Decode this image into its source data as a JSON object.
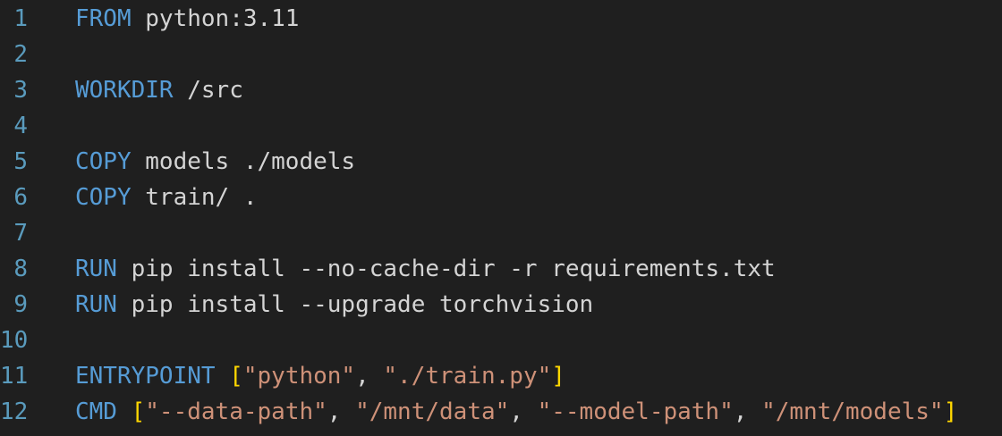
{
  "editor": {
    "language": "Dockerfile",
    "colors": {
      "background": "#1f1f1f",
      "line_number": "#5a9bbd",
      "keyword": "#569cd6",
      "text": "#d4d4d4",
      "bracket": "#ffd700",
      "string": "#ce9178"
    },
    "lines": [
      {
        "number": "1",
        "tokens": [
          {
            "t": "FROM",
            "c": "kw"
          },
          {
            "t": " python:3.11",
            "c": "pl"
          }
        ]
      },
      {
        "number": "2",
        "tokens": []
      },
      {
        "number": "3",
        "tokens": [
          {
            "t": "WORKDIR",
            "c": "kw"
          },
          {
            "t": " /src",
            "c": "pl"
          }
        ]
      },
      {
        "number": "4",
        "tokens": []
      },
      {
        "number": "5",
        "tokens": [
          {
            "t": "COPY",
            "c": "kw"
          },
          {
            "t": " models ./models",
            "c": "pl"
          }
        ]
      },
      {
        "number": "6",
        "tokens": [
          {
            "t": "COPY",
            "c": "kw"
          },
          {
            "t": " train/ .",
            "c": "pl"
          }
        ]
      },
      {
        "number": "7",
        "tokens": []
      },
      {
        "number": "8",
        "tokens": [
          {
            "t": "RUN",
            "c": "kw"
          },
          {
            "t": " pip install --no-cache-dir -r requirements.txt",
            "c": "pl"
          }
        ]
      },
      {
        "number": "9",
        "tokens": [
          {
            "t": "RUN",
            "c": "kw"
          },
          {
            "t": " pip install --upgrade torchvision",
            "c": "pl"
          }
        ]
      },
      {
        "number": "10",
        "tokens": []
      },
      {
        "number": "11",
        "tokens": [
          {
            "t": "ENTRYPOINT",
            "c": "kw"
          },
          {
            "t": " ",
            "c": "pl"
          },
          {
            "t": "[",
            "c": "br"
          },
          {
            "t": "\"python\"",
            "c": "str"
          },
          {
            "t": ", ",
            "c": "pl"
          },
          {
            "t": "\"./train.py\"",
            "c": "str"
          },
          {
            "t": "]",
            "c": "br"
          }
        ]
      },
      {
        "number": "12",
        "tokens": [
          {
            "t": "CMD",
            "c": "kw"
          },
          {
            "t": " ",
            "c": "pl"
          },
          {
            "t": "[",
            "c": "br"
          },
          {
            "t": "\"--data-path\"",
            "c": "str"
          },
          {
            "t": ", ",
            "c": "pl"
          },
          {
            "t": "\"/mnt/data\"",
            "c": "str"
          },
          {
            "t": ", ",
            "c": "pl"
          },
          {
            "t": "\"--model-path\"",
            "c": "str"
          },
          {
            "t": ", ",
            "c": "pl"
          },
          {
            "t": "\"/mnt/models\"",
            "c": "str"
          },
          {
            "t": "]",
            "c": "br"
          }
        ]
      }
    ]
  }
}
